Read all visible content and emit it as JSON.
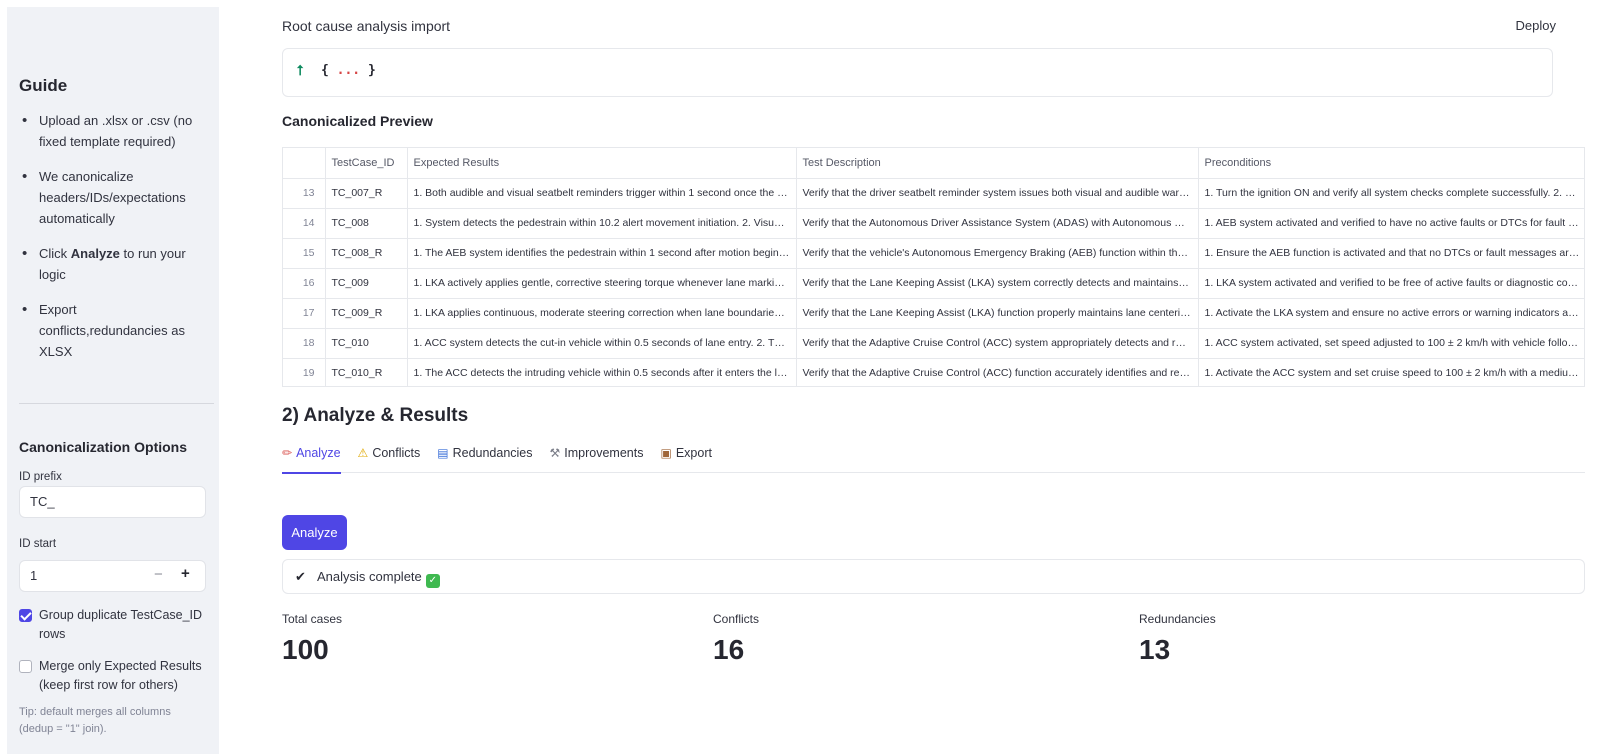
{
  "sidebar": {
    "guide_title": "Guide",
    "guide_items": [
      {
        "before": "Upload an .xlsx or .csv (no fixed template required)",
        "bold": "",
        "after": ""
      },
      {
        "before": "We canonicalize headers/IDs/expectations automatically",
        "bold": "",
        "after": ""
      },
      {
        "before": "Click ",
        "bold": "Analyze",
        "after": " to run your logic"
      },
      {
        "before": "Export conflicts,redundancies as XLSX",
        "bold": "",
        "after": ""
      }
    ],
    "canon_title": "Canonicalization Options",
    "id_prefix_label": "ID prefix",
    "id_prefix_value": "TC_",
    "id_start_label": "ID start",
    "id_start_value": "1",
    "minus": "−",
    "plus": "+",
    "group_dup_label": "Group duplicate TestCase_ID rows",
    "group_dup_checked": true,
    "merge_only_label": "Merge only Expected Results (keep first row for others)",
    "merge_only_checked": false,
    "tip": "Tip: default merges all columns (dedup = \"1\" join)."
  },
  "header": {
    "title": "Root cause analysis import",
    "deploy": "Deploy"
  },
  "json_viewer": {
    "upload_icon": "upload-arrow-icon",
    "open": "{",
    "dots": "...",
    "close": "}"
  },
  "preview": {
    "title": "Canonicalized Preview",
    "columns": [
      "",
      "TestCase_ID",
      "Expected Results",
      "Test Description",
      "Preconditions"
    ],
    "rows": [
      [
        "13",
        "TC_007_R",
        "1. Both audible and visual seatbelt reminders trigger within 1 second once the vehicle starts moving",
        "Verify that the driver seatbelt reminder system issues both visual and audible warnings",
        "1. Turn the ignition ON and verify all system checks complete successfully. 2. Ensure"
      ],
      [
        "14",
        "TC_008",
        "1. System detects the pedestrain within 10.2 alert movement initiation. 2. Visual and audible",
        "Verify that the Autonomous Driver Assistance System (ADAS) with Autonomous Emergency Braking",
        "1. AEB system activated and verified to have no active faults or DTCs for fault message"
      ],
      [
        "15",
        "TC_008_R",
        "1. The AEB system identifies the pedestrain within 1 second after motion begins. 2. Visual",
        "Verify that the vehicle's Autonomous Emergency Braking (AEB) function within the AEB",
        "1. Ensure the AEB function is activated and that no DTCs or fault messages are present"
      ],
      [
        "16",
        "TC_009",
        "1. LKA actively applies gentle, corrective steering torque whenever lane markings are detected",
        "Verify that the Lane Keeping Assist (LKA) system correctly detects and maintains lane position",
        "1. LKA system activated and verified to be free of active faults or diagnostic codes"
      ],
      [
        "17",
        "TC_009_R",
        "1. LKA applies continuous, moderate steering correction when lane boundaries are detected",
        "Verify that the Lane Keeping Assist (LKA) function properly maintains lane centering in",
        "1. Activate the LKA system and ensure no active errors or warning indicators are present"
      ],
      [
        "18",
        "TC_010",
        "1. ACC system detects the cut-in vehicle within 0.5 seconds of lane entry. 2. Throttle/brake",
        "Verify that the Adaptive Cruise Control (ACC) system appropriately detects and responds",
        "1. ACC system activated, set speed adjusted to 100 ± 2 km/h with vehicle following ahead"
      ],
      [
        "19",
        "TC_010_R",
        "1. The ACC detects the intruding vehicle within 0.5 seconds after it enters the lane. 2. The",
        "Verify that the Adaptive Cruise Control (ACC) function accurately identifies and responds",
        "1. Activate the ACC system and set cruise speed to 100 ± 2 km/h with a medium following"
      ]
    ]
  },
  "analyze": {
    "title": "2) Analyze & Results",
    "tabs": [
      {
        "label": "Analyze",
        "icon": "✏",
        "icon_name": "pencil-icon",
        "active": true
      },
      {
        "label": "Conflicts",
        "icon": "⚠",
        "icon_name": "warning-icon",
        "active": false
      },
      {
        "label": "Redundancies",
        "icon": "▤",
        "icon_name": "list-icon",
        "active": false
      },
      {
        "label": "Improvements",
        "icon": "⚒",
        "icon_name": "tools-icon",
        "active": false
      },
      {
        "label": "Export",
        "icon": "▣",
        "icon_name": "package-icon",
        "active": false
      }
    ],
    "button_label": "Analyze",
    "status_text": "Analysis complete",
    "metrics": [
      {
        "label": "Total cases",
        "value": "100"
      },
      {
        "label": "Conflicts",
        "value": "16"
      },
      {
        "label": "Redundancies",
        "value": "13"
      }
    ]
  },
  "colors": {
    "accent": "#4f46e5",
    "sidebar_bg": "#f0f2f6",
    "success": "#3fb950",
    "upload_icon": "#0e8a5f",
    "json_dots": "#d64545"
  }
}
